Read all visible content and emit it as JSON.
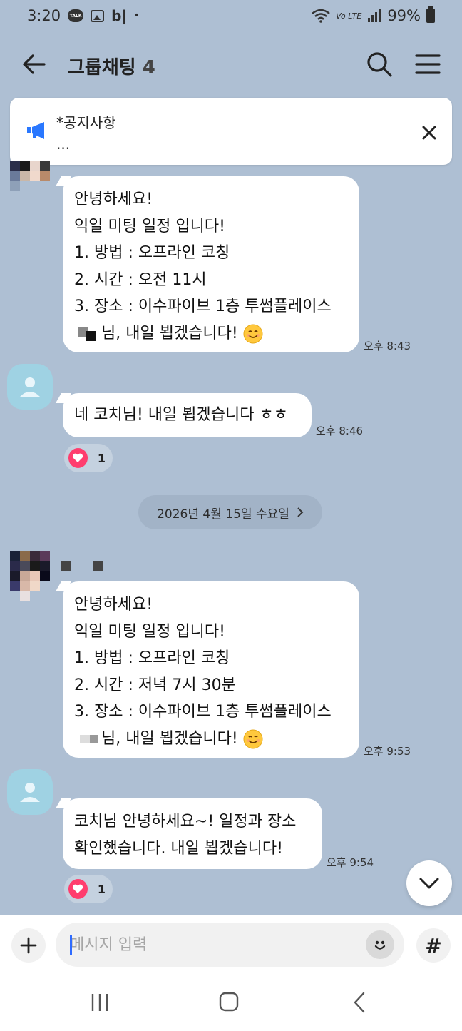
{
  "status_bar": {
    "time": "3:20",
    "talk_icon": "talk-icon",
    "bl_text": "b|",
    "dot": "•",
    "volte_text": "Vo LTE",
    "battery": "99%"
  },
  "header": {
    "title": "그룹채팅",
    "member_count": "4"
  },
  "notice": {
    "title": "*공지사항",
    "preview": "..."
  },
  "messages": [
    {
      "lines": [
        "안녕하세요!",
        "익일 미팅 일정 입니다!",
        "1. 방법 : 오프라인 코칭",
        "2. 시간 : 오전 11시",
        "3. 장소 : 이수파이브 1층 투썸플레이스",
        "님, 내일 뵙겠습니다!"
      ],
      "time": "오후 8:43"
    },
    {
      "lines": [
        "네 코치님! 내일 뵙겠습니다 ㅎㅎ"
      ],
      "time": "오후 8:46",
      "reaction_count": "1"
    },
    {
      "lines": [
        "안녕하세요!",
        "익일 미팅 일정 입니다!",
        "1. 방법 : 오프라인 코칭",
        "2. 시간 : 저녁 7시 30분",
        "3. 장소 : 이수파이브 1층 투썸플레이스",
        "님, 내일 뵙겠습니다!"
      ],
      "time": "오후 9:53"
    },
    {
      "lines": [
        "코치님 안녕하세요~! 일정과 장소",
        "확인했습니다. 내일 뵙겠습니다!"
      ],
      "time": "오후 9:54",
      "reaction_count": "1"
    }
  ],
  "date_divider": "2026년 4월 15일 수요일",
  "input": {
    "placeholder": "메시지 입력"
  },
  "colors": {
    "background": "#aebfd3",
    "bubble": "#ffffff",
    "heart": "#ff3d6e",
    "avatar_default": "#9fd2e3"
  }
}
